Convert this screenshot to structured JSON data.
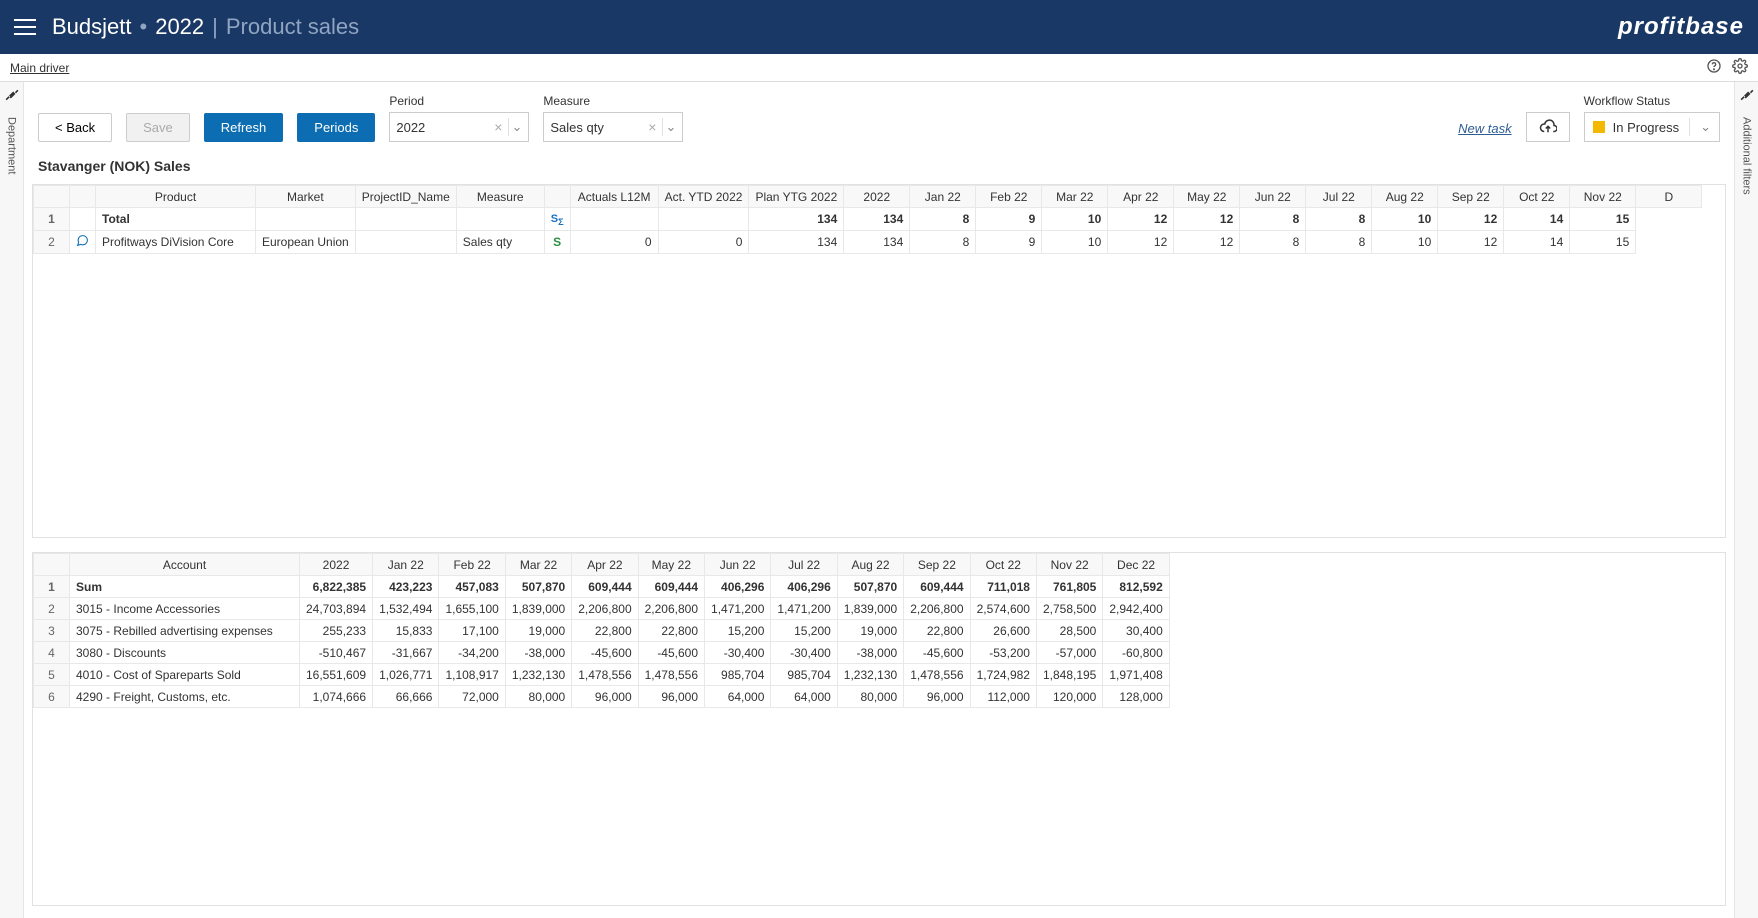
{
  "header": {
    "title_main": "Budsjett",
    "title_year": "2022",
    "title_sub": "Product sales",
    "logo_text": "profitbase"
  },
  "subbar": {
    "main_driver": "Main driver"
  },
  "siderails": {
    "left_label": "Department",
    "right_label": "Additional filters"
  },
  "toolbar": {
    "back": "< Back",
    "save": "Save",
    "refresh": "Refresh",
    "periods": "Periods",
    "period_label": "Period",
    "period_value": "2022",
    "measure_label": "Measure",
    "measure_value": "Sales qty",
    "new_task": "New task",
    "workflow_label": "Workflow Status",
    "workflow_value": "In Progress"
  },
  "grid1": {
    "title": "Stavanger (NOK)  Sales",
    "headers": [
      "",
      "",
      "Product",
      "Market",
      "ProjectID_Name",
      "Measure",
      "",
      "Actuals L12M",
      "Act. YTD 2022",
      "Plan YTG 2022",
      "2022",
      "Jan 22",
      "Feb 22",
      "Mar 22",
      "Apr 22",
      "May 22",
      "Jun 22",
      "Jul 22",
      "Aug 22",
      "Sep 22",
      "Oct 22",
      "Nov 22",
      "D"
    ],
    "rows": [
      {
        "n": "1",
        "icon": "",
        "product": "Total",
        "market": "",
        "proj": "",
        "measure": "",
        "sym": "Σ",
        "actL12M": "",
        "actYTD": "",
        "planYTG": "134",
        "y2022": "134",
        "m": [
          "8",
          "9",
          "10",
          "12",
          "12",
          "8",
          "8",
          "10",
          "12",
          "14",
          "15"
        ]
      },
      {
        "n": "2",
        "icon": "c",
        "product": "Profitways DiVision Core",
        "market": "European Union",
        "proj": "",
        "measure": "Sales qty",
        "sym": "S",
        "actL12M": "0",
        "actYTD": "0",
        "planYTG": "134",
        "y2022": "134",
        "m": [
          "8",
          "9",
          "10",
          "12",
          "12",
          "8",
          "8",
          "10",
          "12",
          "14",
          "15"
        ]
      }
    ]
  },
  "grid2": {
    "headers": [
      "",
      "Account",
      "2022",
      "Jan 22",
      "Feb 22",
      "Mar 22",
      "Apr 22",
      "May 22",
      "Jun 22",
      "Jul 22",
      "Aug 22",
      "Sep 22",
      "Oct 22",
      "Nov 22",
      "Dec 22"
    ],
    "rows": [
      {
        "n": "1",
        "acct": "Sum",
        "bold": true,
        "v": [
          "6,822,385",
          "423,223",
          "457,083",
          "507,870",
          "609,444",
          "609,444",
          "406,296",
          "406,296",
          "507,870",
          "609,444",
          "711,018",
          "761,805",
          "812,592"
        ]
      },
      {
        "n": "2",
        "acct": "3015 - Income Accessories",
        "v": [
          "24,703,894",
          "1,532,494",
          "1,655,100",
          "1,839,000",
          "2,206,800",
          "2,206,800",
          "1,471,200",
          "1,471,200",
          "1,839,000",
          "2,206,800",
          "2,574,600",
          "2,758,500",
          "2,942,400"
        ]
      },
      {
        "n": "3",
        "acct": "3075 - Rebilled advertising expenses",
        "v": [
          "255,233",
          "15,833",
          "17,100",
          "19,000",
          "22,800",
          "22,800",
          "15,200",
          "15,200",
          "19,000",
          "22,800",
          "26,600",
          "28,500",
          "30,400"
        ]
      },
      {
        "n": "4",
        "acct": "3080 - Discounts",
        "v": [
          "-510,467",
          "-31,667",
          "-34,200",
          "-38,000",
          "-45,600",
          "-45,600",
          "-30,400",
          "-30,400",
          "-38,000",
          "-45,600",
          "-53,200",
          "-57,000",
          "-60,800"
        ]
      },
      {
        "n": "5",
        "acct": "4010 - Cost of Spareparts Sold",
        "v": [
          "16,551,609",
          "1,026,771",
          "1,108,917",
          "1,232,130",
          "1,478,556",
          "1,478,556",
          "985,704",
          "985,704",
          "1,232,130",
          "1,478,556",
          "1,724,982",
          "1,848,195",
          "1,971,408"
        ]
      },
      {
        "n": "6",
        "acct": "4290 - Freight, Customs, etc.",
        "v": [
          "1,074,666",
          "66,666",
          "72,000",
          "80,000",
          "96,000",
          "96,000",
          "64,000",
          "64,000",
          "80,000",
          "96,000",
          "112,000",
          "120,000",
          "128,000"
        ]
      }
    ]
  }
}
